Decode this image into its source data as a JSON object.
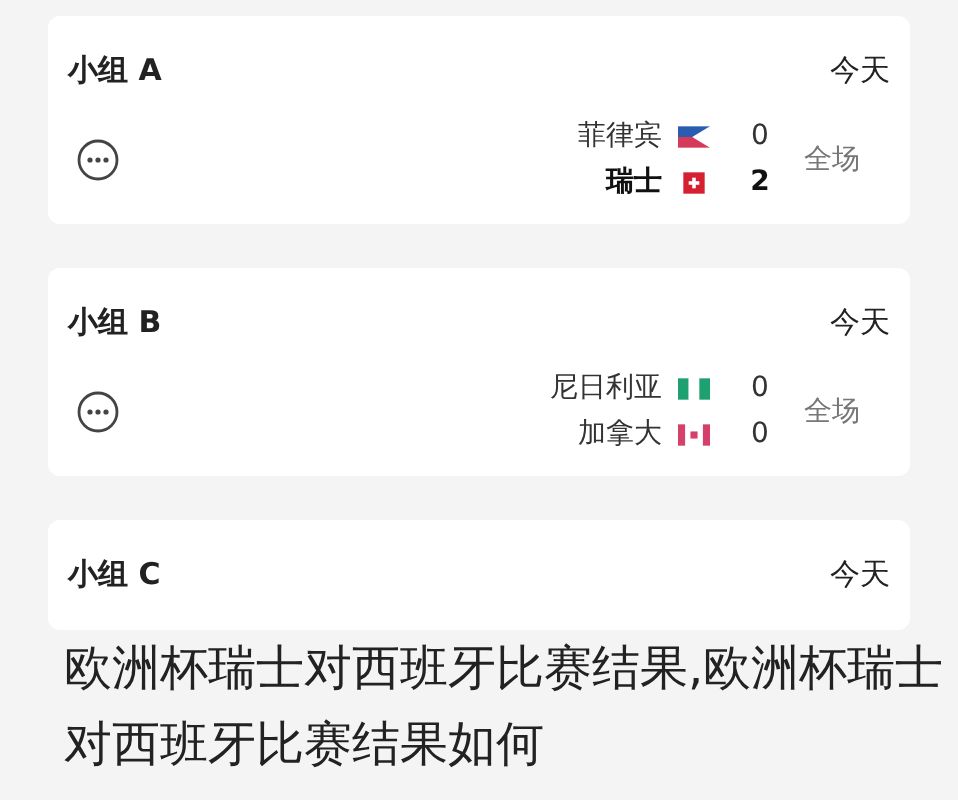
{
  "groups": [
    {
      "title": "小组 A",
      "day": "今天",
      "period": "全场",
      "teams": [
        {
          "name": "菲律宾",
          "score": "0",
          "kind": "philippines",
          "selected": false
        },
        {
          "name": "瑞士",
          "score": "2",
          "kind": "switzerland",
          "selected": true
        }
      ]
    },
    {
      "title": "小组 B",
      "day": "今天",
      "period": "全场",
      "teams": [
        {
          "name": "尼日利亚",
          "score": "0",
          "kind": "nigeria",
          "selected": false
        },
        {
          "name": "加拿大",
          "score": "0",
          "kind": "canada",
          "selected": false
        }
      ]
    },
    {
      "title": "小组 C",
      "day": "今天"
    }
  ],
  "caption": "欧洲杯瑞士对西班牙比赛结果,欧洲杯瑞士对西班牙比赛结果如何"
}
